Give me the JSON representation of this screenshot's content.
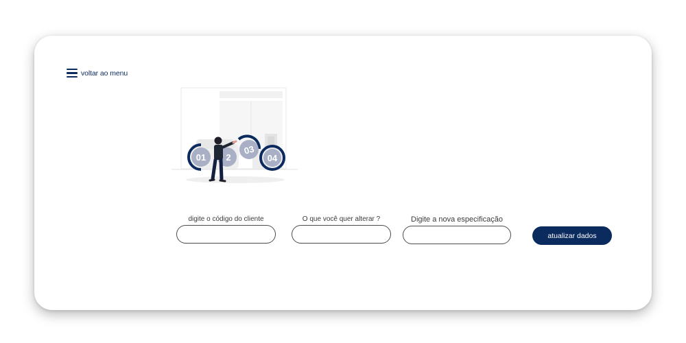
{
  "nav": {
    "back_label": "voltar ao menu",
    "back_icon": "hamburger-menu-icon"
  },
  "illustration": {
    "steps": [
      "01",
      "2",
      "03",
      "04"
    ]
  },
  "form": {
    "client_code_label": "digite o código do cliente",
    "client_code_value": "",
    "change_label": "O que você quer alterar ?",
    "change_value": "",
    "new_spec_label": "Digite a nova especificação",
    "new_spec_value": "",
    "submit_label": "atualizar dados"
  },
  "colors": {
    "brand": "#0b2a5e",
    "circle_fill": "#a9b0c6"
  }
}
